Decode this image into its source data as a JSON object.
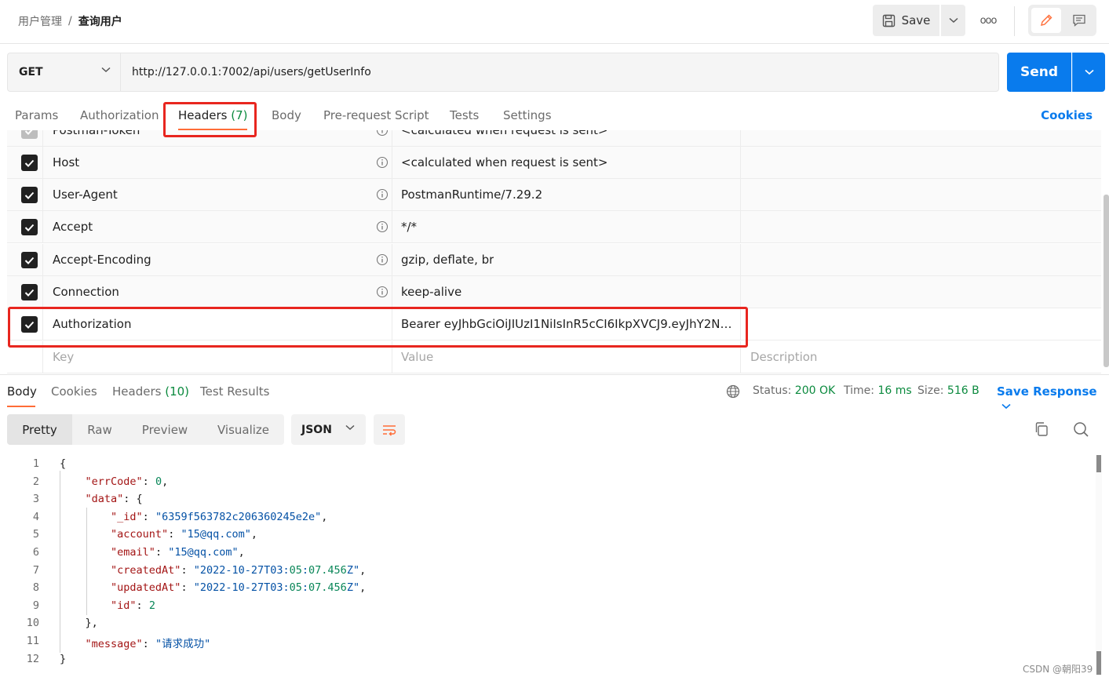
{
  "breadcrumb": {
    "parent": "用户管理",
    "separator": "/",
    "current": "查询用户"
  },
  "toolbar": {
    "save_label": "Save",
    "more_label": "ooo"
  },
  "request": {
    "method": "GET",
    "url": "http://127.0.0.1:7002/api/users/getUserInfo",
    "send_label": "Send"
  },
  "request_tabs": {
    "params": "Params",
    "authorization": "Authorization",
    "headers": "Headers",
    "headers_count": "(7)",
    "body": "Body",
    "prerequest": "Pre-request Script",
    "tests": "Tests",
    "settings": "Settings",
    "cookies": "Cookies"
  },
  "headers": [
    {
      "key": "Postman-Token",
      "value": "<calculated when request is sent>"
    },
    {
      "key": "Host",
      "value": "<calculated when request is sent>"
    },
    {
      "key": "User-Agent",
      "value": "PostmanRuntime/7.29.2"
    },
    {
      "key": "Accept",
      "value": "*/*"
    },
    {
      "key": "Accept-Encoding",
      "value": "gzip, deflate, br"
    },
    {
      "key": "Connection",
      "value": "keep-alive"
    },
    {
      "key": "Authorization",
      "value": "Bearer eyJhbGciOiJIUzI1NiIsInR5cCI6IkpXVCJ9.eyJhY2Nv..."
    }
  ],
  "headers_placeholder": {
    "key": "Key",
    "value": "Value",
    "description": "Description"
  },
  "response": {
    "tabs": {
      "body": "Body",
      "cookies": "Cookies",
      "headers": "Headers",
      "headers_count": "(10)",
      "test_results": "Test Results"
    },
    "status_label": "Status:",
    "status_value": "200 OK",
    "time_label": "Time:",
    "time_value": "16 ms",
    "size_label": "Size:",
    "size_value": "516 B",
    "save_response": "Save Response"
  },
  "view": {
    "pretty": "Pretty",
    "raw": "Raw",
    "preview": "Preview",
    "visualize": "Visualize",
    "format": "JSON"
  },
  "code_lines": [
    "{",
    "    \"errCode\": 0,",
    "    \"data\": {",
    "        \"_id\": \"6359f563782c206360245e2e\",",
    "        \"account\": \"15@qq.com\",",
    "        \"email\": \"15@qq.com\",",
    "        \"createdAt\": \"2022-10-27T03:05:07.456Z\",",
    "        \"updatedAt\": \"2022-10-27T03:05:07.456Z\",",
    "        \"id\": 2",
    "    },",
    "    \"message\": \"请求成功\"",
    "}"
  ],
  "line_numbers": [
    "1",
    "2",
    "3",
    "4",
    "5",
    "6",
    "7",
    "8",
    "9",
    "10",
    "11",
    "12"
  ],
  "watermark": "CSDN @朝阳39",
  "colors": {
    "accent": "#ff6c37",
    "primary": "#097bed",
    "status_ok": "#0b8a3e",
    "highlight_box": "#e8261f"
  }
}
